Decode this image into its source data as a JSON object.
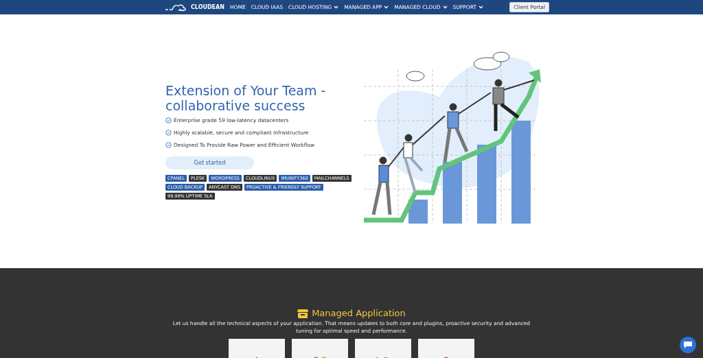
{
  "nav": {
    "brand": "CLOUDEAN",
    "items": [
      {
        "label": "HOME",
        "dropdown": false
      },
      {
        "label": "CLOUD IAAS",
        "dropdown": false
      },
      {
        "label": "CLOUD HOSTING",
        "dropdown": true
      },
      {
        "label": "MANAGED APP",
        "dropdown": true
      },
      {
        "label": "MANAGED CLOUD",
        "dropdown": true
      },
      {
        "label": "SUPPORT",
        "dropdown": true
      }
    ],
    "button": "Client Portal"
  },
  "hero": {
    "title": "Extension of Your Team - collaborative success",
    "features": [
      "Enterprise grade 59 low-latency datacenters",
      "Highly scalable, secure and compliant Infrastructure",
      "Designed To Provide Raw Power and Efficient Workflow"
    ],
    "button": "Get started",
    "tags": [
      {
        "label": "CPANEL",
        "color": "#2a5caa"
      },
      {
        "label": "PLESK",
        "color": "#333333"
      },
      {
        "label": "WORDPRESS",
        "color": "#2a5caa"
      },
      {
        "label": "CLOUDLINUX",
        "color": "#333333"
      },
      {
        "label": "IMUNIFY360",
        "color": "#2a5caa"
      },
      {
        "label": "MAILCHANNELS",
        "color": "#333333"
      },
      {
        "label": "CLOUD BACKUP",
        "color": "#2a5caa"
      },
      {
        "label": "ANYCAST DNS",
        "color": "#333333"
      },
      {
        "label": "PROACTIVE & FRIENDLY SUPPORT",
        "color": "#2a5caa"
      },
      {
        "label": "99.99% UPTIME SLA",
        "color": "#333333"
      }
    ]
  },
  "managed": {
    "title": "Managed Application",
    "text": "Let us handle all the technical aspects of your application. That means updates to both core and plugins, proactive security and advanced tuning for optimal speed and performance.",
    "cards": [
      {
        "kind": "drupal"
      },
      {
        "kind": "joomla"
      },
      {
        "kind": "laravel"
      },
      {
        "kind": "magento"
      }
    ]
  }
}
